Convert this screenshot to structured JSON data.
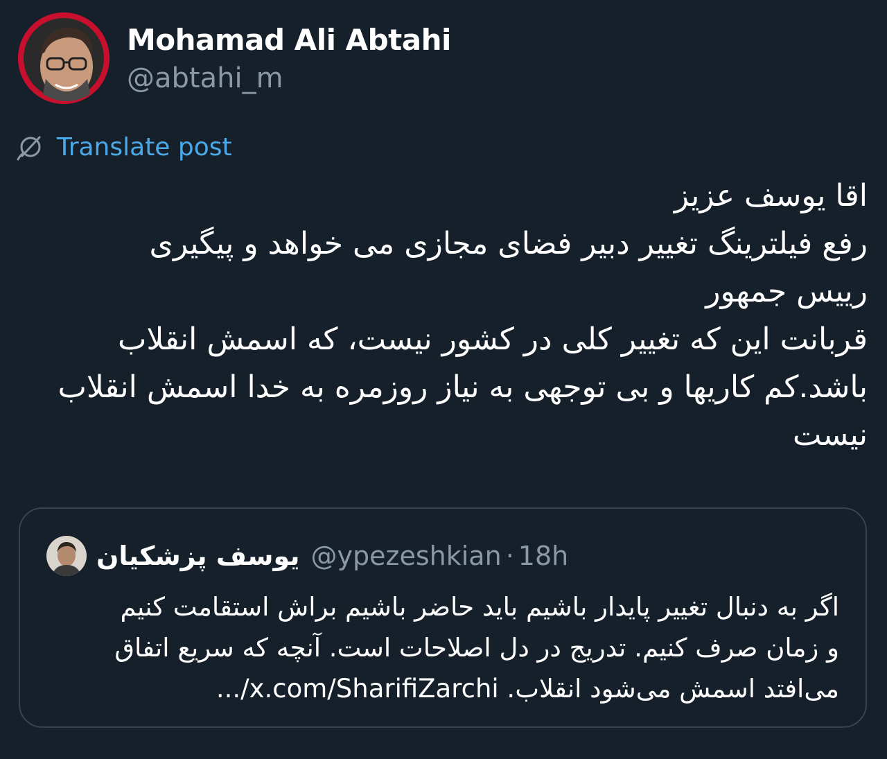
{
  "author": {
    "name": "Mohamad Ali Abtahi",
    "handle": "@abtahi_m"
  },
  "translate": {
    "label": "Translate post",
    "icon": "translate-globe-icon"
  },
  "post": {
    "lines": [
      "اقا یوسف عزیز",
      "رفع فیلترینگ تغییر دبیر فضای مجازی می خواهد و پیگیری",
      "رییس جمهور",
      "قربانت این که تغییر کلی در کشور نیست، که اسمش انقلاب",
      "باشد.کم کاریها و بی توجهی به نیاز روزمره به خدا اسمش انقلاب",
      "نیست"
    ]
  },
  "quoted": {
    "name": "یوسف پزشکیان",
    "handle": "@ypezeshkian",
    "separator": "·",
    "time": "18h",
    "lines": [
      "اگر به دنبال تغییر پایدار باشیم باید حاضر باشیم براش استقامت کنیم",
      "و زمان صرف کنیم. تدریج در دل اصلاحات است. آنچه که سریع اتفاق",
      "می‌افتد اسمش می‌شود انقلاب. x.com/SharifiZarchi/..."
    ]
  },
  "colors": {
    "background": "#15202b",
    "text": "#ffffff",
    "secondary": "#8b98a5",
    "link": "#4aa9e8",
    "border": "#38444d",
    "avatar_ring": "#c8102e"
  }
}
